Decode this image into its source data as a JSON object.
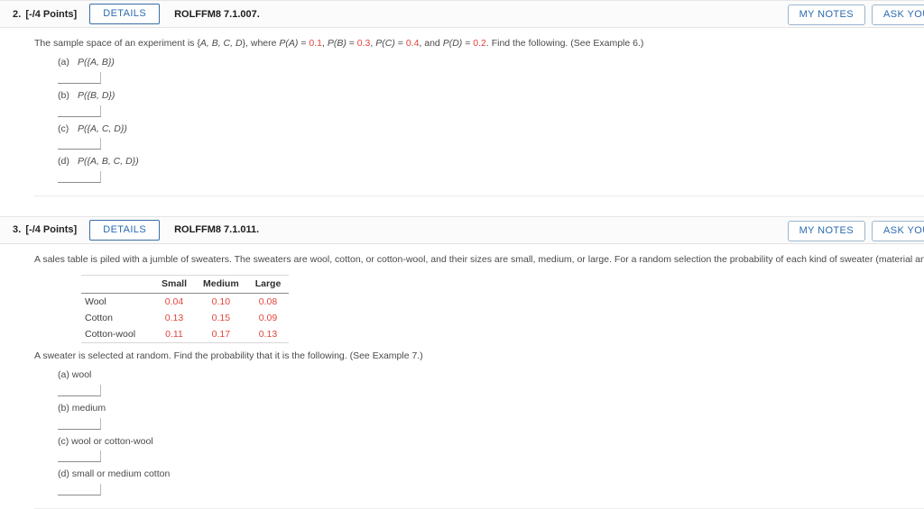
{
  "problems": [
    {
      "number": "2.",
      "points": "[-/4 Points]",
      "details_label": "DETAILS",
      "code": "ROLFFM8 7.1.007.",
      "my_notes_label": "MY NOTES",
      "ask_teacher_label": "ASK YOUR TE",
      "statement_prefix": "The sample space of an experiment is {",
      "statement_set": "A, B, C, D",
      "statement_mid": "}, where ",
      "probabilities": [
        {
          "label": "P(A)",
          "value": "0.1"
        },
        {
          "label": "P(B)",
          "value": "0.3"
        },
        {
          "label": "P(C)",
          "value": "0.4"
        },
        {
          "label": "P(D)",
          "value": "0.2"
        }
      ],
      "statement_suffix": ". Find the following. (See Example 6.)",
      "full_statement": "The sample space of an experiment is {A, B, C, D}, where P(A) = 0.1, P(B) = 0.3, P(C) = 0.4, and P(D) = 0.2. Find the following. (See Example 6.)",
      "parts": [
        {
          "label": "(a)",
          "text": "P({A, B})",
          "value": "",
          "placeholder": ""
        },
        {
          "label": "(b)",
          "text": "P({B, D})",
          "value": "",
          "placeholder": ""
        },
        {
          "label": "(c)",
          "text": "P({A, C, D})",
          "value": "",
          "placeholder": ""
        },
        {
          "label": "(d)",
          "text": "P({A, B, C, D})",
          "value": "",
          "placeholder": ""
        }
      ]
    },
    {
      "number": "3.",
      "points": "[-/4 Points]",
      "details_label": "DETAILS",
      "code": "ROLFFM8 7.1.011.",
      "my_notes_label": "MY NOTES",
      "ask_teacher_label": "ASK YOUR TE",
      "statement": "A sales table is piled with a jumble of sweaters. The sweaters are wool, cotton, or cotton-wool, and their sizes are small, medium, or large. For a random selection the probability of each kind of sweater (material and size) being selected is given in the following table.",
      "sub_statement": "A sweater is selected at random. Find the probability that it is the following. (See Example 7.)",
      "table": {
        "corner": "",
        "columns": [
          "Small",
          "Medium",
          "Large"
        ],
        "rows": [
          {
            "name": "Wool",
            "values": [
              "0.04",
              "0.10",
              "0.08"
            ]
          },
          {
            "name": "Cotton",
            "values": [
              "0.13",
              "0.15",
              "0.09"
            ]
          },
          {
            "name": "Cotton-wool",
            "values": [
              "0.11",
              "0.17",
              "0.13"
            ]
          }
        ]
      },
      "parts": [
        {
          "label": "(a)",
          "text": "wool",
          "value": "",
          "placeholder": ""
        },
        {
          "label": "(b)",
          "text": "medium",
          "value": "",
          "placeholder": ""
        },
        {
          "label": "(c)",
          "text": "wool or cotton-wool",
          "value": "",
          "placeholder": ""
        },
        {
          "label": "(d)",
          "text": "small or medium cotton",
          "value": "",
          "placeholder": ""
        }
      ]
    }
  ],
  "colors": {
    "value_red": "#e2453c",
    "link_blue": "#2a6ab0",
    "details_border": "#3b6ea5",
    "header_bg": "#fbfbfb"
  }
}
